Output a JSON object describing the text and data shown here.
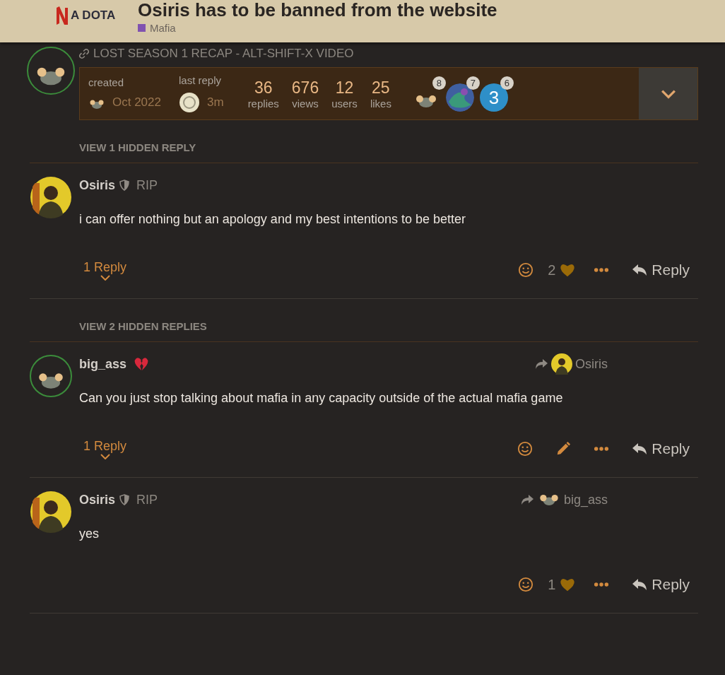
{
  "header": {
    "logo_text": "A DOTA",
    "title": "Osiris has to be banned from the website",
    "category": {
      "name": "Mafia",
      "color": "#8052b0"
    }
  },
  "topic_link": "LOST SEASON 1 RECAP - ALT-SHIFT-X VIDEO",
  "topic_map": {
    "avatar": {
      "kind": "mouse"
    },
    "ring": true,
    "created_label": "created",
    "created": "Oct 2022",
    "last_reply_label": "last reply",
    "last_reply": "3m",
    "stats": [
      {
        "value": "36",
        "label": "replies"
      },
      {
        "value": "676",
        "label": "views"
      },
      {
        "value": "12",
        "label": "users"
      },
      {
        "value": "25",
        "label": "likes"
      }
    ],
    "participants": [
      {
        "kind": "mouse",
        "count": "8"
      },
      {
        "kind": "swirl",
        "count": "7"
      },
      {
        "kind": "letter",
        "letter": "3",
        "color": "#2e8fc8",
        "count": "6"
      }
    ]
  },
  "stream": [
    {
      "kind": "hidden",
      "label": "VIEW 1 HIDDEN REPLY"
    },
    {
      "kind": "post",
      "avatar": {
        "kind": "figure"
      },
      "ring": false,
      "author": "Osiris",
      "shield": true,
      "title": "RIP",
      "broken_heart": false,
      "body": "i can offer nothing but an apology and my best intentions to be better",
      "replies_label": "1 Reply",
      "actions": [
        {
          "kind": "emoji"
        },
        {
          "kind": "like",
          "count": "2"
        },
        {
          "kind": "more"
        }
      ],
      "reply": "Reply"
    },
    {
      "kind": "hidden",
      "label": "VIEW 2 HIDDEN REPLIES"
    },
    {
      "kind": "post",
      "avatar": {
        "kind": "mouse"
      },
      "ring": true,
      "author": "big_ass",
      "shield": false,
      "broken_heart": true,
      "reply_to": {
        "avatar": {
          "kind": "figure"
        },
        "name": "Osiris"
      },
      "body": "Can you just stop talking about mafia in any capacity outside of the actual mafia game",
      "replies_label": "1 Reply",
      "actions": [
        {
          "kind": "emoji"
        },
        {
          "kind": "edit"
        },
        {
          "kind": "more"
        }
      ],
      "reply": "Reply"
    },
    {
      "kind": "post",
      "avatar": {
        "kind": "figure"
      },
      "ring": false,
      "author": "Osiris",
      "shield": true,
      "title": "RIP",
      "broken_heart": false,
      "reply_to": {
        "avatar": {
          "kind": "mouse"
        },
        "name": "big_ass"
      },
      "body": "yes",
      "actions": [
        {
          "kind": "emoji"
        },
        {
          "kind": "like",
          "count": "1"
        },
        {
          "kind": "more"
        }
      ],
      "reply": "Reply"
    }
  ]
}
